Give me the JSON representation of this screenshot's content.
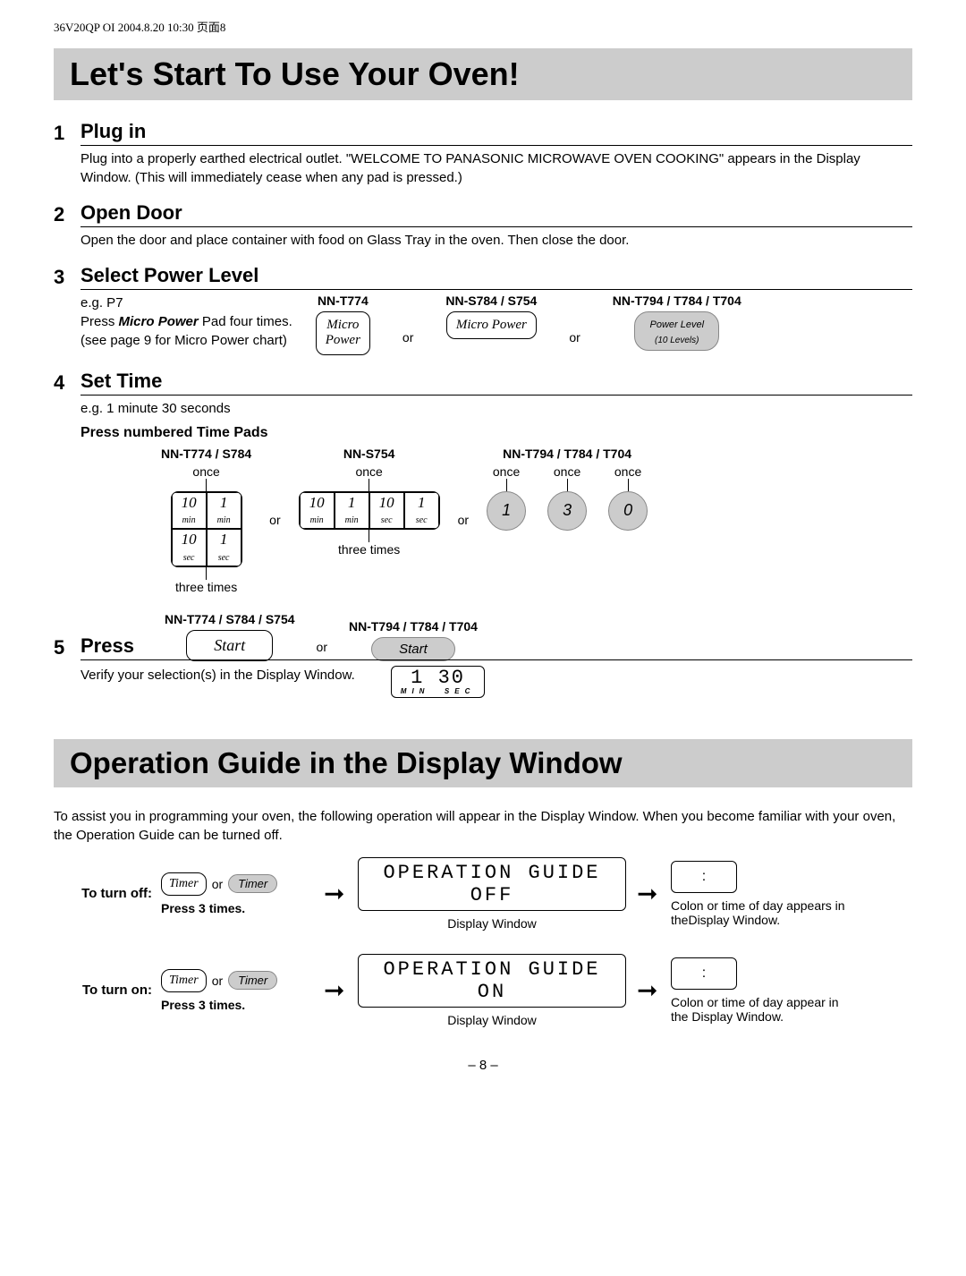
{
  "header_small": "36V20QP OI  2004.8.20  10:30  页面8",
  "banner1": "Let's Start To Use Your Oven!",
  "steps": {
    "s1": {
      "num": "1",
      "title": "Plug in",
      "text": "Plug into a properly earthed electrical outlet. \"WELCOME TO PANASONIC MICROWAVE OVEN COOKING\" appears in the Display Window. (This will immediately cease when any pad is pressed.)"
    },
    "s2": {
      "num": "2",
      "title": "Open Door",
      "text": "Open the door and place container with food on Glass Tray in the oven. Then close the door."
    },
    "s3": {
      "num": "3",
      "title": "Select Power Level",
      "eg": "e.g. P7",
      "press_line_a": "Press ",
      "press_line_b": "Micro Power",
      "press_line_c": " Pad four times.",
      "see": "(see page 9 for Micro Power chart)",
      "models": {
        "m1": {
          "label": "NN-T774",
          "btn_l1": "Micro",
          "btn_l2": "Power"
        },
        "m2": {
          "label": "NN-S784 / S754",
          "btn": "Micro Power"
        },
        "m3": {
          "label": "NN-T794 / T784 / T704",
          "btn_l1": "Power Level",
          "btn_l2": "(10 Levels)"
        }
      },
      "or": "or"
    },
    "s4": {
      "num": "4",
      "title": "Set Time",
      "eg": "e.g. 1 minute 30 seconds",
      "sub": "Press numbered Time Pads",
      "groups": {
        "g1": {
          "label": "NN-T774 / S784",
          "once": "once",
          "three": "three times",
          "pads": [
            {
              "v": "10",
              "u": "min"
            },
            {
              "v": "1",
              "u": "min"
            },
            {
              "v": "10",
              "u": "sec"
            },
            {
              "v": "1",
              "u": "sec"
            }
          ]
        },
        "g2": {
          "label": "NN-S754",
          "once": "once",
          "three": "three times",
          "pads": [
            {
              "v": "10",
              "u": "min"
            },
            {
              "v": "1",
              "u": "min"
            },
            {
              "v": "10",
              "u": "sec"
            },
            {
              "v": "1",
              "u": "sec"
            }
          ]
        },
        "g3": {
          "label": "NN-T794 / T784 / T704",
          "once": "once",
          "digits": [
            "1",
            "3",
            "0"
          ]
        }
      },
      "or": "or"
    },
    "s5": {
      "num": "5",
      "title": "Press",
      "models": {
        "m1": {
          "label": "NN-T774 / S784 / S754",
          "btn": "Start"
        },
        "m2": {
          "label": "NN-T794 / T784 / T704",
          "btn": "Start"
        }
      },
      "or": "or",
      "verify": "Verify your selection(s) in the Display Window.",
      "lcd_digits": "1  30",
      "lcd_unit_min": "MIN",
      "lcd_unit_sec": "SEC"
    }
  },
  "banner2": "Operation Guide in the Display Window",
  "guide_intro": "To assist you in programming your oven, the following operation will appear in the Display Window. When you become familiar with your oven, the Operation Guide can be turned off.",
  "guide": {
    "off": {
      "label": "To turn off:",
      "timer": "Timer",
      "or": "or",
      "press3": "Press 3 times.",
      "display": "OPERATION GUIDE OFF",
      "display_caption": "Display Window",
      "colon": ":",
      "result": "Colon or time of day appears in theDisplay Window."
    },
    "on": {
      "label": "To turn on:",
      "timer": "Timer",
      "or": "or",
      "press3": "Press 3 times.",
      "display": "OPERATION GUIDE ON",
      "display_caption": "Display Window",
      "colon": ":",
      "result": "Colon or time of day appear in the Display Window."
    }
  },
  "page_number": "– 8 –"
}
